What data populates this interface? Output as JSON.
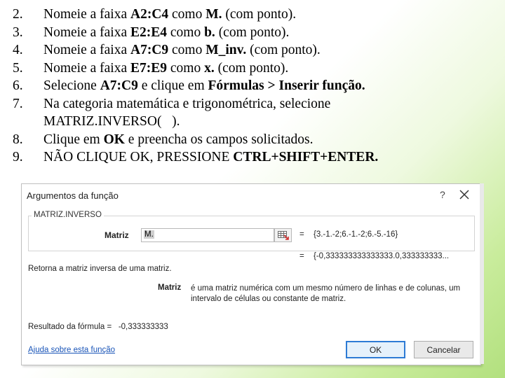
{
  "steps": [
    {
      "num": "2.",
      "parts": [
        {
          "t": "Nomeie a faixa ",
          "b": false
        },
        {
          "t": "A2:C4",
          "b": true
        },
        {
          "t": " como ",
          "b": false
        },
        {
          "t": "M.",
          "b": true
        },
        {
          "t": " (com ponto).",
          "b": false
        }
      ]
    },
    {
      "num": "3.",
      "parts": [
        {
          "t": "Nomeie a faixa ",
          "b": false
        },
        {
          "t": "E2:E4",
          "b": true
        },
        {
          "t": " como ",
          "b": false
        },
        {
          "t": "b.",
          "b": true
        },
        {
          "t": " (com ponto).",
          "b": false
        }
      ]
    },
    {
      "num": "4.",
      "parts": [
        {
          "t": "Nomeie a faixa ",
          "b": false
        },
        {
          "t": "A7:C9",
          "b": true
        },
        {
          "t": " como ",
          "b": false
        },
        {
          "t": "M_inv.",
          "b": true
        },
        {
          "t": " (com ponto).",
          "b": false
        }
      ]
    },
    {
      "num": "5.",
      "parts": [
        {
          "t": "Nomeie a faixa ",
          "b": false
        },
        {
          "t": "E7:E9",
          "b": true
        },
        {
          "t": " como ",
          "b": false
        },
        {
          "t": "x.",
          "b": true
        },
        {
          "t": " (com ponto).",
          "b": false
        }
      ]
    },
    {
      "num": "6.",
      "parts": [
        {
          "t": "Selecione ",
          "b": false
        },
        {
          "t": "A7:C9",
          "b": true
        },
        {
          "t": " e clique em ",
          "b": false
        },
        {
          "t": "Fórmulas > Inserir função.",
          "b": true
        }
      ]
    },
    {
      "num": "7.",
      "parts": [
        {
          "t": "Na categoria matemática e trigonométrica, selecione\nMATRIZ.INVERSO(   ).",
          "b": false
        }
      ]
    },
    {
      "num": "8.",
      "parts": [
        {
          "t": "Clique em ",
          "b": false
        },
        {
          "t": "OK",
          "b": true
        },
        {
          "t": " e preencha os campos solicitados.",
          "b": false
        }
      ]
    },
    {
      "num": "9.",
      "parts": [
        {
          "t": "NÃO CLIQUE OK, PRESSIONE ",
          "b": false
        },
        {
          "t": "CTRL+SHIFT+ENTER.",
          "b": true
        }
      ]
    }
  ],
  "dialog": {
    "title": "Argumentos da função",
    "help": "?",
    "group_title": "MATRIZ.INVERSO",
    "arg_label": "Matriz",
    "arg_value": "M.",
    "eq": "=",
    "arg_result": "{3.-1.-2;6.-1.-2;6.-5.-16}",
    "formula_result_preview": "{-0,333333333333333.0,333333333...",
    "description": "Retorna a matriz inversa de uma matriz.",
    "arg_name": "Matriz",
    "arg_description": "é uma matriz numérica com um mesmo número de linhas e de colunas, um intervalo de células ou constante de matriz.",
    "formula_label": "Resultado da fórmula =",
    "formula_value": "-0,333333333",
    "help_link": "Ajuda sobre esta função",
    "ok": "OK",
    "cancel": "Cancelar"
  }
}
